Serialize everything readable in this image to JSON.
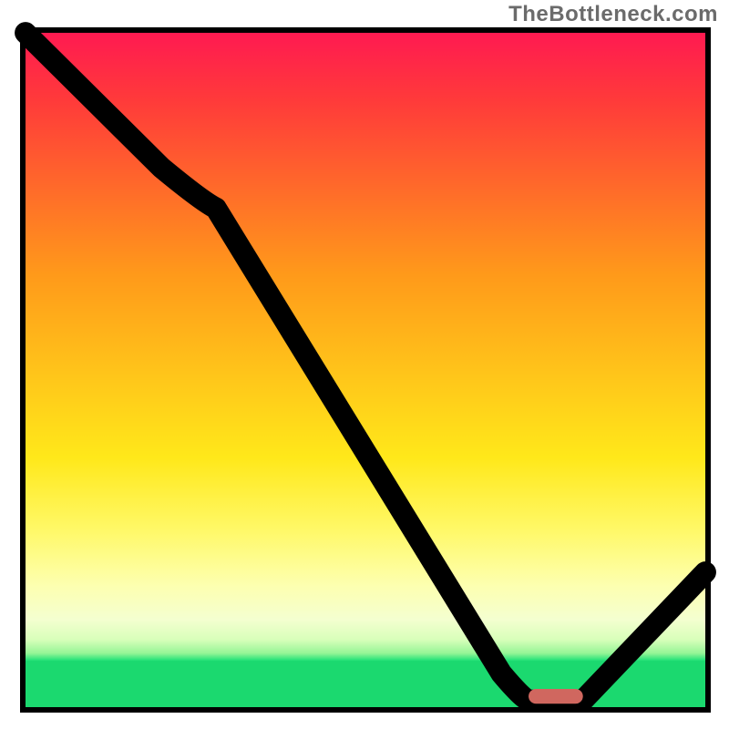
{
  "watermark": "TheBottleneck.com",
  "chart_data": {
    "type": "line",
    "title": "",
    "xlabel": "",
    "ylabel": "",
    "xlim": [
      0,
      100
    ],
    "ylim": [
      0,
      100
    ],
    "grid": false,
    "legend": false,
    "series": [
      {
        "name": "bottleneck-curve",
        "x": [
          0,
          20,
          28,
          70,
          74,
          82,
          100
        ],
        "values": [
          100,
          80,
          74,
          5,
          1,
          1,
          20
        ]
      }
    ],
    "marker": {
      "name": "optimum-range",
      "x_start": 74,
      "x_end": 82,
      "y": 1,
      "color": "#d0675f"
    },
    "background_gradient": {
      "top": "#ff1a51",
      "mid": "#ffe81a",
      "bottom": "#1bd96f"
    }
  }
}
